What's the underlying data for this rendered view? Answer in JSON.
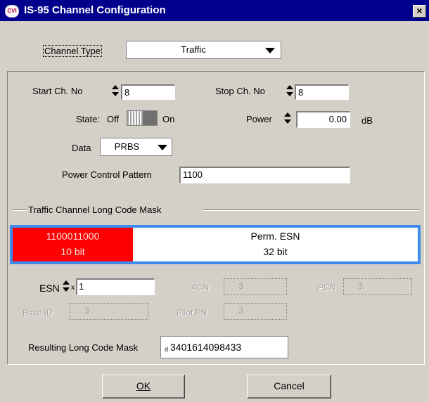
{
  "window": {
    "title": "IS-95 Channel Configuration",
    "icon": "cvi-icon",
    "close_glyph": "×",
    "accent": "#00008c"
  },
  "channel_type": {
    "label": "Channel Type",
    "value": "Traffic"
  },
  "start_ch": {
    "label": "Start Ch. No",
    "value": "8"
  },
  "stop_ch": {
    "label": "Stop Ch. No",
    "value": "8"
  },
  "state": {
    "label": "State:",
    "off": "Off",
    "on": "On"
  },
  "power": {
    "label": "Power",
    "value": "0.00",
    "unit": "dB"
  },
  "data": {
    "label": "Data",
    "value": "PRBS"
  },
  "power_control": {
    "label": "Power Control Pattern",
    "value": "1100"
  },
  "long_code": {
    "group_label": "Traffic Channel Long Code Mask",
    "red_color": "#ff0000",
    "border_color": "#3c8cf0",
    "left_value": "1100011000",
    "left_bits": "10 bit",
    "right_label": "Perm. ESN",
    "right_bits": "32 bit"
  },
  "esn": {
    "label": "ESN",
    "prefix": "x",
    "value": "1"
  },
  "acn": {
    "label": "ACN",
    "value": "3"
  },
  "pcn": {
    "label": "PCN",
    "value": "3"
  },
  "base_id": {
    "label": "Base ID",
    "value": "3"
  },
  "pilot_pn": {
    "label": "Pilot PN",
    "value": "3"
  },
  "resulting": {
    "label": "Resulting Long Code Mask",
    "prefix": "d",
    "value": "3401614098433"
  },
  "buttons": {
    "ok": "OK",
    "cancel": "Cancel"
  }
}
